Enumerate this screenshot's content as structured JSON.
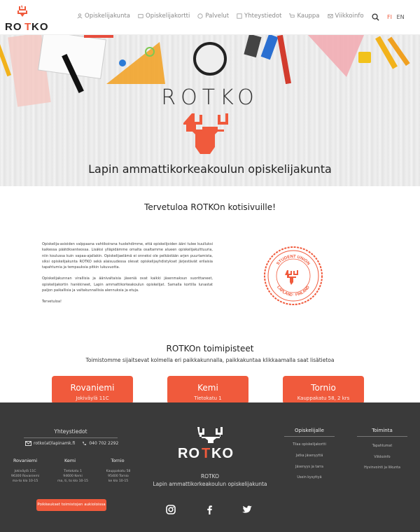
{
  "nav": {
    "items": [
      {
        "label": "Opiskelijakunta",
        "icon": "person-icon"
      },
      {
        "label": "Opiskelijakortti",
        "icon": "card-icon"
      },
      {
        "label": "Palvelut",
        "icon": "palette-icon"
      },
      {
        "label": "Yhteystiedot",
        "icon": "contact-icon"
      },
      {
        "label": "Kauppa",
        "icon": "cart-icon"
      },
      {
        "label": "Viikkoinfo",
        "icon": "mail-icon"
      }
    ],
    "lang_fi": "FI",
    "lang_en": "EN"
  },
  "brand": {
    "logo_text": "ROTKO",
    "accent": "#f05a3c"
  },
  "hero": {
    "title": "ROTKO",
    "subtitle": "Lapin ammattikorkeakoulun opiskelijakunta"
  },
  "welcome": {
    "title": "Tervetuloa ROTKOn kotisivuille!",
    "paragraphs": [
      "Opiskelija-asioiden valppaana vahtikoirana huolehdimme, että opiskelijoiden ääni tulee kuulluksi kaikessa päätöksenteossa. Lisäksi ylläpidämme omalta osaltamme alueen opiskelijakulttuuria, niin koulussa kuin vapaa-ajallakin. Opiskelijaelämä ei onneksi ole pelkästään arjen puurtamista, siksi opiskelijakunta ROTKO sekä alaisuudessa olevat opiskelijayhdistykset järjestävät erilaisia tapahtumia ja tempauksia pitkin lukuvuotta.",
      "Opiskelijakunnan virallisia ja äänivaltaisia jäseniä ovat kaikki jäsenmaksun suorittaneet, opiskelijakortin hankkineet, Lapin ammattikorkeakoulun opiskelijat. Samalla kortilla lunastat paljon paikallisia ja valtakunnallisia alennuksia ja etuja.",
      "Tervetuloa!"
    ],
    "badge_text_top": "STUDENT UNION",
    "badge_text_bottom": "LAPLAND · FINLAND"
  },
  "offices": {
    "title": "ROTKOn toimipisteet",
    "subtitle": "Toimistomme sijaitsevat kolmella eri paikkakunnalla, paikkakuntaa klikkaamalla saat lisätietoa",
    "cards": [
      {
        "city": "Rovaniemi",
        "address": "Jokiväylä 11C"
      },
      {
        "city": "Kemi",
        "address": "Tietokatu 1"
      },
      {
        "city": "Tornio",
        "address": "Kauppakatu 58, 2 krs"
      }
    ]
  },
  "footer": {
    "contact_title": "Yhteystiedot",
    "email": "rotko(at)lapinamk.fi",
    "phone": "040 702 2292",
    "cities": [
      {
        "name": "Rovaniemi",
        "lines": [
          "Jokiväylä 11C",
          "96300 Rovaniemi",
          "ma-to klo 10-15"
        ]
      },
      {
        "name": "Kemi",
        "lines": [
          "Tietokatu 1",
          "94600 Kemi",
          "ma, ti, to klo 10-15"
        ]
      },
      {
        "name": "Tornio",
        "lines": [
          "Kauppakatu 58",
          "95400 Tornio",
          "ke klo 10-15"
        ]
      }
    ],
    "open_hours_button": "Poikkeukset toimistojen aukioloissa",
    "org_name": "ROTKO",
    "org_full": "Lapin ammattikorkeakoulun opiskelijakunta",
    "col1_title": "Opiskelijalle",
    "col1_items": [
      "Tilaa opiskelijakortti",
      "Jatka jäsenyyttä",
      "Jäsenyys ja tarra",
      "Usein kysyttyä"
    ],
    "col2_title": "Toiminta",
    "col2_items": [
      "Tapahtumat",
      "Viikkoinfo",
      "Hyvinvointi ja liikunta"
    ]
  }
}
